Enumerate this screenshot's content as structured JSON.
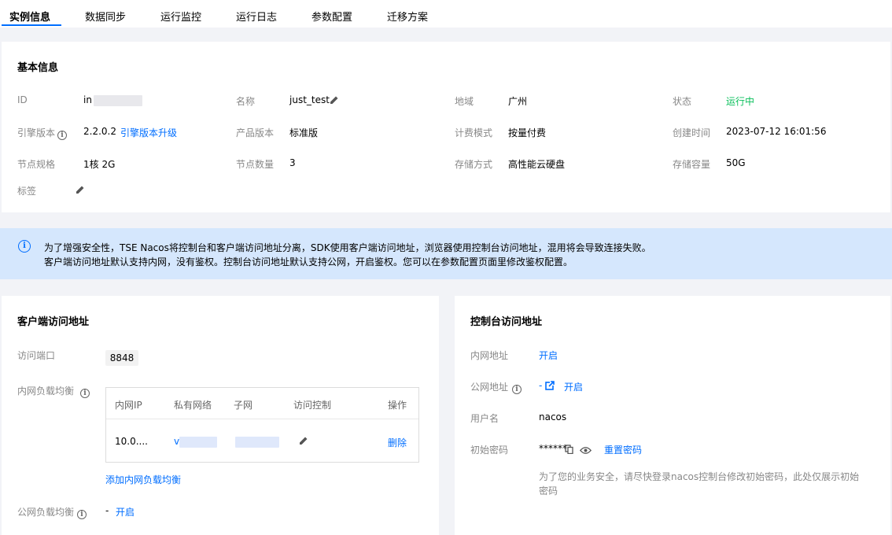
{
  "tabs": [
    {
      "label": "实例信息",
      "active": true
    },
    {
      "label": "数据同步"
    },
    {
      "label": "运行监控"
    },
    {
      "label": "运行日志"
    },
    {
      "label": "参数配置"
    },
    {
      "label": "迁移方案"
    }
  ],
  "basic": {
    "title": "基本信息",
    "id_label": "ID",
    "id_value": "in",
    "name_label": "名称",
    "name_value": "just_test",
    "region_label": "地域",
    "region_value": "广州",
    "status_label": "状态",
    "status_value": "运行中",
    "engine_label": "引擎版本",
    "engine_value": "2.2.0.2",
    "engine_upgrade": "引擎版本升级",
    "product_label": "产品版本",
    "product_value": "标准版",
    "billing_label": "计费模式",
    "billing_value": "按量付费",
    "created_label": "创建时间",
    "created_value": "2023-07-12 16:01:56",
    "spec_label": "节点规格",
    "spec_value": "1核 2G",
    "nodes_label": "节点数量",
    "nodes_value": "3",
    "storage_label": "存储方式",
    "storage_value": "高性能云硬盘",
    "capacity_label": "存储容量",
    "capacity_value": "50G",
    "tag_label": "标签"
  },
  "notice": {
    "line1": "为了增强安全性，TSE Nacos将控制台和客户端访问地址分离，SDK使用客户端访问地址，浏览器使用控制台访问地址，混用将会导致连接失败。",
    "line2": "客户端访问地址默认支持内网，没有鉴权。控制台访问地址默认支持公网，开启鉴权。您可以在参数配置页面里修改鉴权配置。"
  },
  "client": {
    "title": "客户端访问地址",
    "port_label": "访问端口",
    "port_value": "8848",
    "intranet_lb_label": "内网负载均衡",
    "table": {
      "headers": [
        "内网IP",
        "私有网络",
        "子网",
        "访问控制",
        "操作"
      ],
      "row": {
        "ip": "10.0....",
        "vpc": "v",
        "action": "删除"
      }
    },
    "add_lb": "添加内网负载均衡",
    "public_lb_label": "公网负载均衡",
    "public_lb_value": "-",
    "public_lb_action": "开启"
  },
  "console": {
    "title": "控制台访问地址",
    "intranet_label": "内网地址",
    "intranet_action": "开启",
    "public_label": "公网地址",
    "public_value": "-",
    "public_action": "开启",
    "user_label": "用户名",
    "user_value": "nacos",
    "pwd_label": "初始密码",
    "pwd_value": "******",
    "pwd_reset": "重置密码",
    "pwd_tip_line1": "为了您的业务安全，请尽快登录nacos控制台修改初始密码，此处仅展示初始",
    "pwd_tip_line2": "密码"
  },
  "icons": {
    "info": "info-icon",
    "edit": "pencil-icon",
    "copy": "copy-icon",
    "eye": "eye-icon",
    "external": "external-link-icon"
  },
  "colors": {
    "accent": "#006eff",
    "success": "#0abf5b",
    "notice_bg": "#d5e7fd"
  }
}
